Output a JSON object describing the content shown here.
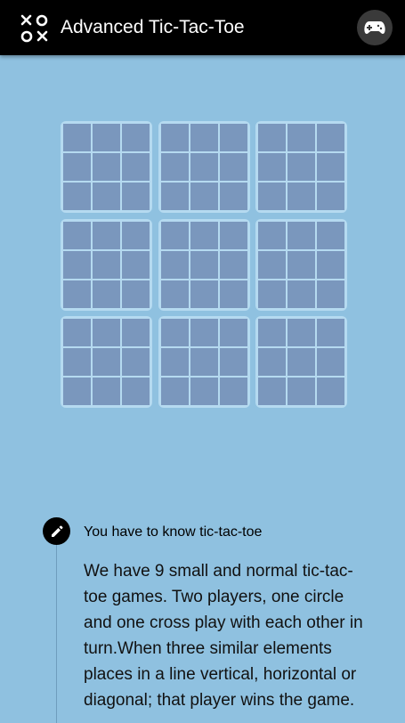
{
  "app": {
    "title": "Advanced Tic-Tac-Toe",
    "logo_icon": "xo-logo-icon",
    "game_icon": "gamepad-icon"
  },
  "board": {
    "mini_boards": 9,
    "cells_per_board": 9,
    "cell_color": "#7a97bd",
    "border_color": "#b5daf0"
  },
  "rule": {
    "icon": "pencil-icon",
    "title": "You have to know tic-tac-toe",
    "text": "We have 9 small and normal tic-tac-toe games. Two players, one circle and one cross play with each other in turn.When three similar elements places in a line vertical, horizontal or diagonal; that player wins the game."
  },
  "colors": {
    "background": "#8fc1e0",
    "topbar": "#000000"
  }
}
